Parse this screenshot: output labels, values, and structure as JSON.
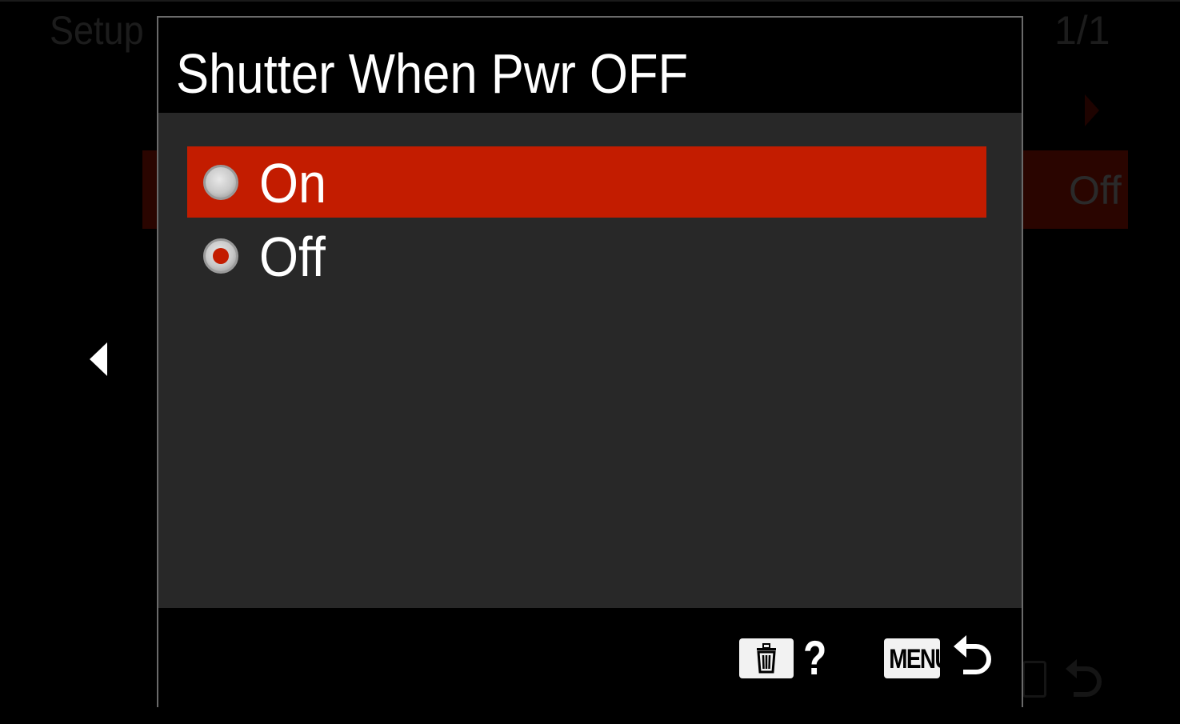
{
  "background_menu": {
    "title": "Setup",
    "page_indicator": "1/1",
    "row_value": "Off"
  },
  "dialog": {
    "title": "Shutter When Pwr OFF",
    "options": [
      {
        "label": "On",
        "highlighted": true,
        "checked": false
      },
      {
        "label": "Off",
        "highlighted": false,
        "checked": true
      }
    ],
    "footer": {
      "help_glyph": "?",
      "menu_label": "MENU",
      "delete_icon": "trash-icon",
      "back_icon": "return-arrow-icon"
    }
  },
  "colors": {
    "highlight": "#c31c00",
    "dialog_body": "#282828",
    "dialog_border": "#6a6a6a"
  }
}
